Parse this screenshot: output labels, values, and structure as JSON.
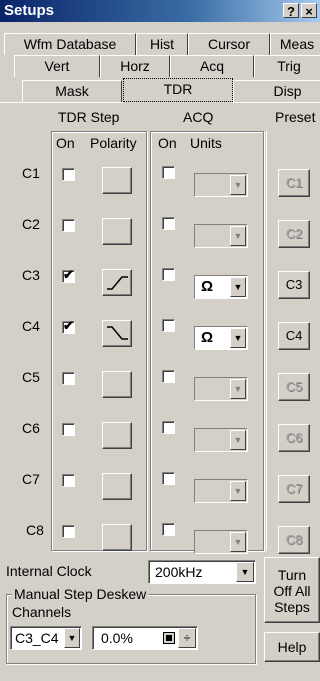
{
  "window": {
    "title": "Setups",
    "help_glyph": "?",
    "close_glyph": "×"
  },
  "tabs": {
    "row1": [
      "Wfm Database",
      "Hist",
      "Cursor",
      "Meas"
    ],
    "row2": [
      "Vert",
      "Horz",
      "Acq",
      "Trig"
    ],
    "row3": [
      "Mask",
      "TDR",
      "Disp"
    ],
    "active": "TDR"
  },
  "tdr_step": {
    "title": "TDR Step",
    "on_header": "On",
    "polarity_header": "Polarity"
  },
  "acq": {
    "title": "ACQ",
    "on_header": "On",
    "units_header": "Units"
  },
  "preset": {
    "title": "Preset"
  },
  "channels": [
    {
      "label": "C1",
      "step_on": false,
      "polarity": "",
      "acq_on": false,
      "units": "",
      "enabled": false,
      "preset": "C1"
    },
    {
      "label": "C2",
      "step_on": false,
      "polarity": "",
      "acq_on": false,
      "units": "",
      "enabled": false,
      "preset": "C2"
    },
    {
      "label": "C3",
      "step_on": true,
      "polarity": "rising",
      "acq_on": false,
      "units": "Ω",
      "enabled": true,
      "preset": "C3"
    },
    {
      "label": "C4",
      "step_on": true,
      "polarity": "falling",
      "acq_on": false,
      "units": "Ω",
      "enabled": true,
      "preset": "C4"
    },
    {
      "label": "C5",
      "step_on": false,
      "polarity": "",
      "acq_on": false,
      "units": "",
      "enabled": false,
      "preset": "C5"
    },
    {
      "label": "C6",
      "step_on": false,
      "polarity": "",
      "acq_on": false,
      "units": "",
      "enabled": false,
      "preset": "C6"
    },
    {
      "label": "C7",
      "step_on": false,
      "polarity": "",
      "acq_on": false,
      "units": "",
      "enabled": false,
      "preset": "C7"
    },
    {
      "label": "C8",
      "step_on": false,
      "polarity": "",
      "acq_on": false,
      "units": "",
      "enabled": false,
      "preset": "C8"
    }
  ],
  "internal_clock": {
    "label": "Internal Clock",
    "value": "200kHz"
  },
  "deskew": {
    "title": "Manual Step Deskew",
    "channels_label": "Channels",
    "channels_value": "C3_C4",
    "value": "0.0%"
  },
  "buttons": {
    "turn_off_line1": "Turn",
    "turn_off_line2": "Off All",
    "turn_off_line3": "Steps",
    "help": "Help"
  }
}
